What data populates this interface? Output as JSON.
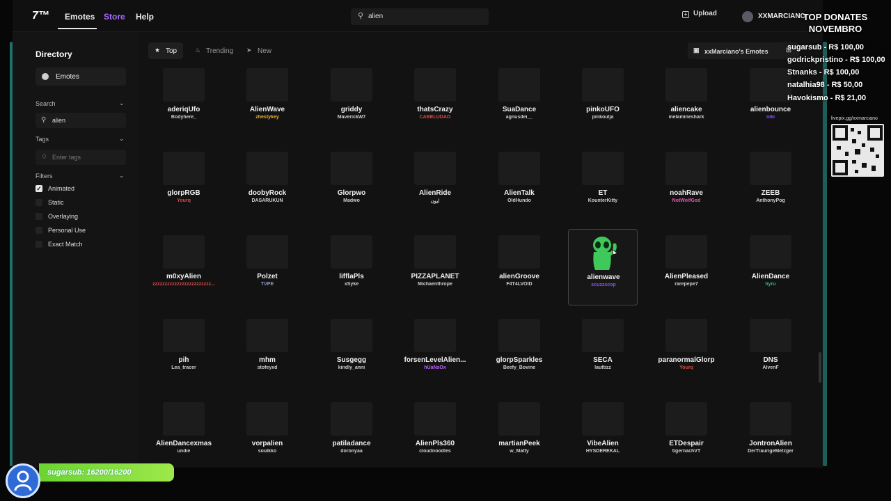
{
  "nav": {
    "logo": "7™",
    "emotes": "Emotes",
    "store": "Store",
    "help": "Help",
    "search_value": "alien",
    "upload": "Upload",
    "username": "XXMARCIANO"
  },
  "sidebar": {
    "title": "Directory",
    "emotes_item": "Emotes",
    "search_head": "Search",
    "search_value": "alien",
    "tags_head": "Tags",
    "tags_placeholder": "Enter tags",
    "filters_head": "Filters",
    "filters": [
      {
        "label": "Animated",
        "checked": true
      },
      {
        "label": "Static",
        "checked": false
      },
      {
        "label": "Overlaying",
        "checked": false
      },
      {
        "label": "Personal Use",
        "checked": false
      },
      {
        "label": "Exact Match",
        "checked": false
      }
    ]
  },
  "toolbar": {
    "tab_top": "Top",
    "tab_trending": "Trending",
    "tab_new": "New",
    "my_emotes": "xxMarciano's Emotes"
  },
  "emotes": [
    {
      "name": "aderiqUfo",
      "author": "Bodyhere_",
      "author_color": "#cfcfcf"
    },
    {
      "name": "AlienWave",
      "author": "zhestykey",
      "author_color": "#f0b429"
    },
    {
      "name": "griddy",
      "author": "MaverickW7",
      "author_color": "#cfcfcf"
    },
    {
      "name": "thatsCrazy",
      "author": "CABELUDAO",
      "author_color": "#d84a4a"
    },
    {
      "name": "SuaDance",
      "author": "agnusdei__",
      "author_color": "#cfcfcf"
    },
    {
      "name": "pinkoUFO",
      "author": "pinkoulja",
      "author_color": "#cfcfcf"
    },
    {
      "name": "aliencake",
      "author": "melamineshark",
      "author_color": "#cfcfcf"
    },
    {
      "name": "alienbounce",
      "author": "niki",
      "author_color": "#8a4dff"
    },
    {
      "name": "glorpRGB",
      "author": "Yourq",
      "author_color": "#d84a4a"
    },
    {
      "name": "doobyRock",
      "author": "DASARUKUN",
      "author_color": "#cfcfcf"
    },
    {
      "name": "Glorpwo",
      "author": "Madwo",
      "author_color": "#cfcfcf"
    },
    {
      "name": "AlienRide",
      "author": "ليون",
      "author_color": "#cfcfcf"
    },
    {
      "name": "AlienTalk",
      "author": "OldHundo",
      "author_color": "#cfcfcf"
    },
    {
      "name": "ET",
      "author": "KounterKitty",
      "author_color": "#cfcfcf"
    },
    {
      "name": "noahRave",
      "author": "NotWolfGod",
      "author_color": "#e05aa8"
    },
    {
      "name": "ZEEB",
      "author": "AnthonyPog",
      "author_color": "#cfcfcf"
    },
    {
      "name": "m0xyAlien",
      "author": "zzzzzzzzzzzzzzzzzzzzzzzz...",
      "author_color": "#d84a4a"
    },
    {
      "name": "Polzet",
      "author": "TVPE",
      "author_color": "#8aa0c8"
    },
    {
      "name": "lifflaPls",
      "author": "xSyke",
      "author_color": "#cfcfcf"
    },
    {
      "name": "PIZZAPLANET",
      "author": "Michaenthrope",
      "author_color": "#cfcfcf"
    },
    {
      "name": "alienGroove",
      "author": "F4T4LVOID",
      "author_color": "#cfcfcf"
    },
    {
      "name": "alienwave",
      "author": "scuzzscop",
      "author_color": "#8a4dff"
    },
    {
      "name": "AlienPleased",
      "author": "rarepepe7",
      "author_color": "#cfcfcf"
    },
    {
      "name": "AlienDance",
      "author": "hyru",
      "author_color": "#2fb8a0"
    },
    {
      "name": "pih",
      "author": "Lea_tracer",
      "author_color": "#cfcfcf"
    },
    {
      "name": "mhm",
      "author": "stofeyxd",
      "author_color": "#cfcfcf"
    },
    {
      "name": "Susgegg",
      "author": "kindly_anni",
      "author_color": "#cfcfcf"
    },
    {
      "name": "forsenLevelAlien...",
      "author": "hUaNsOx",
      "author_color": "#c060ff"
    },
    {
      "name": "glorpSparkles",
      "author": "Beefy_Bovine",
      "author_color": "#cfcfcf"
    },
    {
      "name": "SECA",
      "author": "lauttizz",
      "author_color": "#cfcfcf"
    },
    {
      "name": "paranormalGlorp",
      "author": "Yourq",
      "author_color": "#d84a4a"
    },
    {
      "name": "DNS",
      "author": "AlvenF",
      "author_color": "#cfcfcf"
    },
    {
      "name": "AlienDancexmas",
      "author": "undie",
      "author_color": "#cfcfcf"
    },
    {
      "name": "vorpalien",
      "author": "soulkko",
      "author_color": "#cfcfcf"
    },
    {
      "name": "patiladance",
      "author": "doronyaa",
      "author_color": "#cfcfcf"
    },
    {
      "name": "AlienPls360",
      "author": "cloudnoodles",
      "author_color": "#cfcfcf"
    },
    {
      "name": "martianPeek",
      "author": "w_Matty",
      "author_color": "#cfcfcf"
    },
    {
      "name": "VibeAlien",
      "author": "HYSDEREKAL",
      "author_color": "#cfcfcf"
    },
    {
      "name": "ETDespair",
      "author": "tigernachVT",
      "author_color": "#cfcfcf"
    },
    {
      "name": "JontronAlien",
      "author": "DerTraurigeMetzger",
      "author_color": "#cfcfcf"
    }
  ],
  "selected_emote": "alienwave",
  "overlay": {
    "title_line1": "TOP DONATES",
    "title_line2": "NOVEMBRO",
    "donors": [
      "sugarsub - R$ 100,00",
      "godrickpristino - R$ 100,00",
      "Stnanks - R$ 100,00",
      "natalhia98 - R$ 50,00",
      "Havokismo - R$ 21,00"
    ],
    "qr_label": "livepix.gg/xxmarciano",
    "sub_goal": "sugarsub: 16200/16200"
  },
  "colors": {
    "accent": "#a86cff",
    "alien_green": "#3ec95a",
    "sub_bar": "#7ad83a"
  }
}
